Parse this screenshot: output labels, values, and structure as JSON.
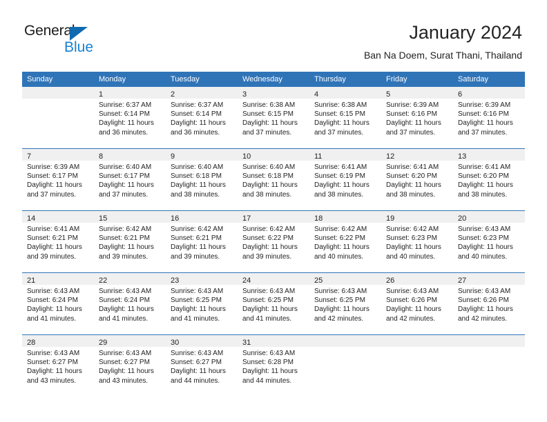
{
  "logo": {
    "word_one": "General",
    "word_two": "Blue",
    "triangle_color": "#0f6ab0",
    "blue_text_color": "#1881d0"
  },
  "header": {
    "title": "January 2024",
    "subtitle": "Ban Na Doem, Surat Thani, Thailand"
  },
  "theme": {
    "header_blue": "#3074b8",
    "daynum_band": "#f0f0f0",
    "text": "#222222"
  },
  "weekday_headers": [
    "Sunday",
    "Monday",
    "Tuesday",
    "Wednesday",
    "Thursday",
    "Friday",
    "Saturday"
  ],
  "weeks": [
    [
      {
        "day": "",
        "sunrise": "",
        "sunset": "",
        "daylight_line1": "",
        "daylight_line2": ""
      },
      {
        "day": "1",
        "sunrise": "Sunrise: 6:37 AM",
        "sunset": "Sunset: 6:14 PM",
        "daylight_line1": "Daylight: 11 hours",
        "daylight_line2": "and 36 minutes."
      },
      {
        "day": "2",
        "sunrise": "Sunrise: 6:37 AM",
        "sunset": "Sunset: 6:14 PM",
        "daylight_line1": "Daylight: 11 hours",
        "daylight_line2": "and 36 minutes."
      },
      {
        "day": "3",
        "sunrise": "Sunrise: 6:38 AM",
        "sunset": "Sunset: 6:15 PM",
        "daylight_line1": "Daylight: 11 hours",
        "daylight_line2": "and 37 minutes."
      },
      {
        "day": "4",
        "sunrise": "Sunrise: 6:38 AM",
        "sunset": "Sunset: 6:15 PM",
        "daylight_line1": "Daylight: 11 hours",
        "daylight_line2": "and 37 minutes."
      },
      {
        "day": "5",
        "sunrise": "Sunrise: 6:39 AM",
        "sunset": "Sunset: 6:16 PM",
        "daylight_line1": "Daylight: 11 hours",
        "daylight_line2": "and 37 minutes."
      },
      {
        "day": "6",
        "sunrise": "Sunrise: 6:39 AM",
        "sunset": "Sunset: 6:16 PM",
        "daylight_line1": "Daylight: 11 hours",
        "daylight_line2": "and 37 minutes."
      }
    ],
    [
      {
        "day": "7",
        "sunrise": "Sunrise: 6:39 AM",
        "sunset": "Sunset: 6:17 PM",
        "daylight_line1": "Daylight: 11 hours",
        "daylight_line2": "and 37 minutes."
      },
      {
        "day": "8",
        "sunrise": "Sunrise: 6:40 AM",
        "sunset": "Sunset: 6:17 PM",
        "daylight_line1": "Daylight: 11 hours",
        "daylight_line2": "and 37 minutes."
      },
      {
        "day": "9",
        "sunrise": "Sunrise: 6:40 AM",
        "sunset": "Sunset: 6:18 PM",
        "daylight_line1": "Daylight: 11 hours",
        "daylight_line2": "and 38 minutes."
      },
      {
        "day": "10",
        "sunrise": "Sunrise: 6:40 AM",
        "sunset": "Sunset: 6:18 PM",
        "daylight_line1": "Daylight: 11 hours",
        "daylight_line2": "and 38 minutes."
      },
      {
        "day": "11",
        "sunrise": "Sunrise: 6:41 AM",
        "sunset": "Sunset: 6:19 PM",
        "daylight_line1": "Daylight: 11 hours",
        "daylight_line2": "and 38 minutes."
      },
      {
        "day": "12",
        "sunrise": "Sunrise: 6:41 AM",
        "sunset": "Sunset: 6:20 PM",
        "daylight_line1": "Daylight: 11 hours",
        "daylight_line2": "and 38 minutes."
      },
      {
        "day": "13",
        "sunrise": "Sunrise: 6:41 AM",
        "sunset": "Sunset: 6:20 PM",
        "daylight_line1": "Daylight: 11 hours",
        "daylight_line2": "and 38 minutes."
      }
    ],
    [
      {
        "day": "14",
        "sunrise": "Sunrise: 6:41 AM",
        "sunset": "Sunset: 6:21 PM",
        "daylight_line1": "Daylight: 11 hours",
        "daylight_line2": "and 39 minutes."
      },
      {
        "day": "15",
        "sunrise": "Sunrise: 6:42 AM",
        "sunset": "Sunset: 6:21 PM",
        "daylight_line1": "Daylight: 11 hours",
        "daylight_line2": "and 39 minutes."
      },
      {
        "day": "16",
        "sunrise": "Sunrise: 6:42 AM",
        "sunset": "Sunset: 6:21 PM",
        "daylight_line1": "Daylight: 11 hours",
        "daylight_line2": "and 39 minutes."
      },
      {
        "day": "17",
        "sunrise": "Sunrise: 6:42 AM",
        "sunset": "Sunset: 6:22 PM",
        "daylight_line1": "Daylight: 11 hours",
        "daylight_line2": "and 39 minutes."
      },
      {
        "day": "18",
        "sunrise": "Sunrise: 6:42 AM",
        "sunset": "Sunset: 6:22 PM",
        "daylight_line1": "Daylight: 11 hours",
        "daylight_line2": "and 40 minutes."
      },
      {
        "day": "19",
        "sunrise": "Sunrise: 6:42 AM",
        "sunset": "Sunset: 6:23 PM",
        "daylight_line1": "Daylight: 11 hours",
        "daylight_line2": "and 40 minutes."
      },
      {
        "day": "20",
        "sunrise": "Sunrise: 6:43 AM",
        "sunset": "Sunset: 6:23 PM",
        "daylight_line1": "Daylight: 11 hours",
        "daylight_line2": "and 40 minutes."
      }
    ],
    [
      {
        "day": "21",
        "sunrise": "Sunrise: 6:43 AM",
        "sunset": "Sunset: 6:24 PM",
        "daylight_line1": "Daylight: 11 hours",
        "daylight_line2": "and 41 minutes."
      },
      {
        "day": "22",
        "sunrise": "Sunrise: 6:43 AM",
        "sunset": "Sunset: 6:24 PM",
        "daylight_line1": "Daylight: 11 hours",
        "daylight_line2": "and 41 minutes."
      },
      {
        "day": "23",
        "sunrise": "Sunrise: 6:43 AM",
        "sunset": "Sunset: 6:25 PM",
        "daylight_line1": "Daylight: 11 hours",
        "daylight_line2": "and 41 minutes."
      },
      {
        "day": "24",
        "sunrise": "Sunrise: 6:43 AM",
        "sunset": "Sunset: 6:25 PM",
        "daylight_line1": "Daylight: 11 hours",
        "daylight_line2": "and 41 minutes."
      },
      {
        "day": "25",
        "sunrise": "Sunrise: 6:43 AM",
        "sunset": "Sunset: 6:25 PM",
        "daylight_line1": "Daylight: 11 hours",
        "daylight_line2": "and 42 minutes."
      },
      {
        "day": "26",
        "sunrise": "Sunrise: 6:43 AM",
        "sunset": "Sunset: 6:26 PM",
        "daylight_line1": "Daylight: 11 hours",
        "daylight_line2": "and 42 minutes."
      },
      {
        "day": "27",
        "sunrise": "Sunrise: 6:43 AM",
        "sunset": "Sunset: 6:26 PM",
        "daylight_line1": "Daylight: 11 hours",
        "daylight_line2": "and 42 minutes."
      }
    ],
    [
      {
        "day": "28",
        "sunrise": "Sunrise: 6:43 AM",
        "sunset": "Sunset: 6:27 PM",
        "daylight_line1": "Daylight: 11 hours",
        "daylight_line2": "and 43 minutes."
      },
      {
        "day": "29",
        "sunrise": "Sunrise: 6:43 AM",
        "sunset": "Sunset: 6:27 PM",
        "daylight_line1": "Daylight: 11 hours",
        "daylight_line2": "and 43 minutes."
      },
      {
        "day": "30",
        "sunrise": "Sunrise: 6:43 AM",
        "sunset": "Sunset: 6:27 PM",
        "daylight_line1": "Daylight: 11 hours",
        "daylight_line2": "and 44 minutes."
      },
      {
        "day": "31",
        "sunrise": "Sunrise: 6:43 AM",
        "sunset": "Sunset: 6:28 PM",
        "daylight_line1": "Daylight: 11 hours",
        "daylight_line2": "and 44 minutes."
      },
      {
        "day": "",
        "sunrise": "",
        "sunset": "",
        "daylight_line1": "",
        "daylight_line2": ""
      },
      {
        "day": "",
        "sunrise": "",
        "sunset": "",
        "daylight_line1": "",
        "daylight_line2": ""
      },
      {
        "day": "",
        "sunrise": "",
        "sunset": "",
        "daylight_line1": "",
        "daylight_line2": ""
      }
    ]
  ]
}
